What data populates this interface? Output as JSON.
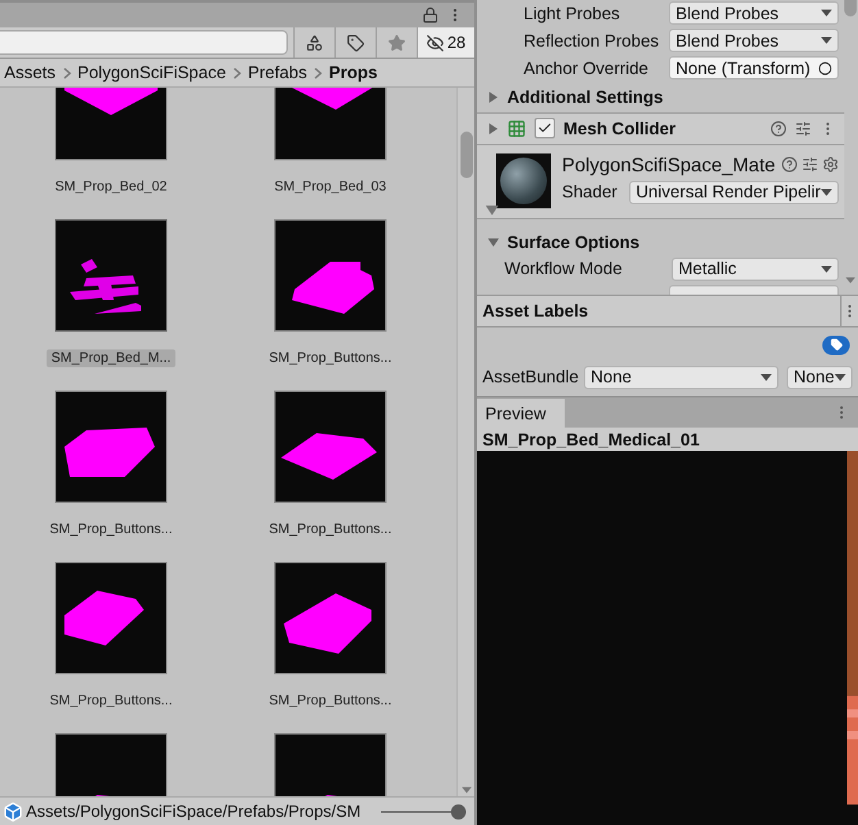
{
  "project": {
    "hidden_count": "28",
    "breadcrumb": [
      {
        "label": "Assets",
        "current": false
      },
      {
        "label": "PolygonSciFiSpace",
        "current": false
      },
      {
        "label": "Prefabs",
        "current": false
      },
      {
        "label": "Props",
        "current": true
      }
    ],
    "assets": [
      {
        "name": "SM_Prop_Bed_02",
        "selected": false
      },
      {
        "name": "SM_Prop_Bed_03",
        "selected": false
      },
      {
        "name": "SM_Prop_Bed_M...",
        "selected": true
      },
      {
        "name": "SM_Prop_Buttons...",
        "selected": false
      },
      {
        "name": "SM_Prop_Buttons...",
        "selected": false
      },
      {
        "name": "SM_Prop_Buttons...",
        "selected": false
      },
      {
        "name": "SM_Prop_Buttons...",
        "selected": false
      },
      {
        "name": "SM_Prop_Buttons...",
        "selected": false
      },
      {
        "selected": false
      },
      {
        "selected": false
      }
    ],
    "path": "Assets/PolygonSciFiSpace/Prefabs/Props/SM",
    "zoom": {
      "level": 1
    }
  },
  "inspector": {
    "properties": [
      {
        "label": "Light Probes",
        "value": "Blend Probes",
        "kind": "dropdown"
      },
      {
        "label": "Reflection Probes",
        "value": "Blend Probes",
        "kind": "dropdown"
      },
      {
        "label": "Anchor Override",
        "value": "None (Transform)",
        "kind": "object"
      }
    ],
    "additional_settings": {
      "label": "Additional Settings",
      "expanded": false
    },
    "mesh_collider": {
      "label": "Mesh Collider",
      "enabled": true,
      "expanded": false
    },
    "material": {
      "name": "PolygonScifiSpace_Mate",
      "shader_label": "Shader",
      "shader": "Universal Render Pipelir",
      "expanded": true
    },
    "surface_options": {
      "label": "Surface Options",
      "expanded": true,
      "properties": [
        {
          "label": "Workflow Mode",
          "value": "Metallic"
        }
      ]
    }
  },
  "asset_labels": {
    "title": "Asset Labels"
  },
  "asset_bundle": {
    "label": "AssetBundle",
    "value": "None",
    "variant": "None"
  },
  "preview": {
    "tab": "Preview",
    "title": "SM_Prop_Bed_Medical_01"
  }
}
